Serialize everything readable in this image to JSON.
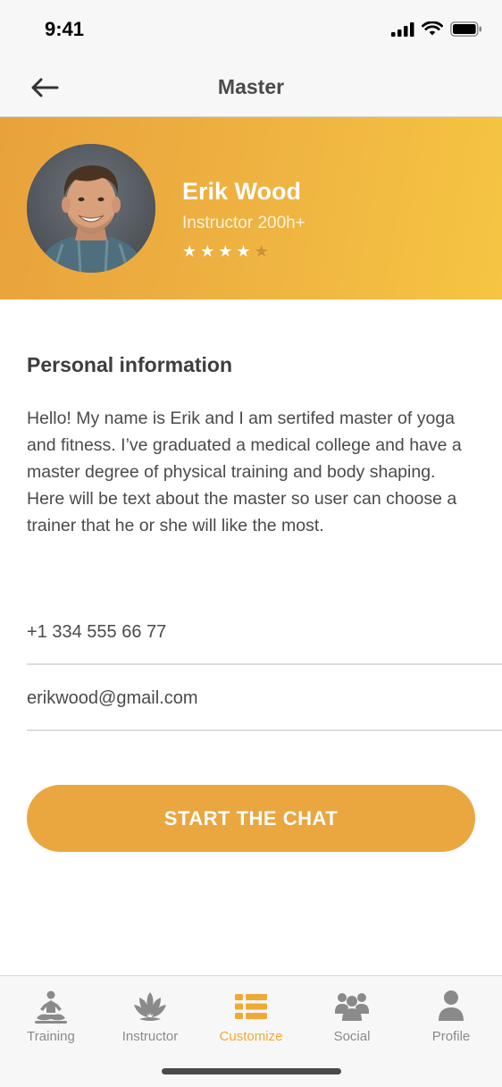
{
  "status_bar": {
    "time": "9:41"
  },
  "nav": {
    "title": "Master",
    "back_icon": "arrow-left-icon"
  },
  "profile": {
    "name": "Erik Wood",
    "role": "Instructor 200h+",
    "rating": 4,
    "rating_max": 5
  },
  "personal_info": {
    "title": "Personal information",
    "bio": "Hello! My name is Erik and I am sertifed master of yoga and fitness. I’ve graduated a medical college and have a master degree of physical training and body shaping. Here will be text about the master so user can choose a trainer that he or she will like the most."
  },
  "contacts": {
    "phone": "+1 334 555 66 77",
    "email": "erikwood@gmail.com"
  },
  "actions": {
    "start_chat_label": "START THE CHAT"
  },
  "tabs": [
    {
      "label": "Training",
      "icon": "meditation-icon",
      "active": false
    },
    {
      "label": "Instructor",
      "icon": "lotus-icon",
      "active": false
    },
    {
      "label": "Customize",
      "icon": "list-icon",
      "active": true
    },
    {
      "label": "Social",
      "icon": "group-icon",
      "active": false
    },
    {
      "label": "Profile",
      "icon": "user-icon",
      "active": false
    }
  ],
  "colors": {
    "accent": "#eaa63f",
    "accent_active": "#f0a935",
    "hero_gradient_start": "#e8a23c",
    "hero_gradient_end": "#f6c543",
    "inactive_tab": "#8a8a8a"
  }
}
